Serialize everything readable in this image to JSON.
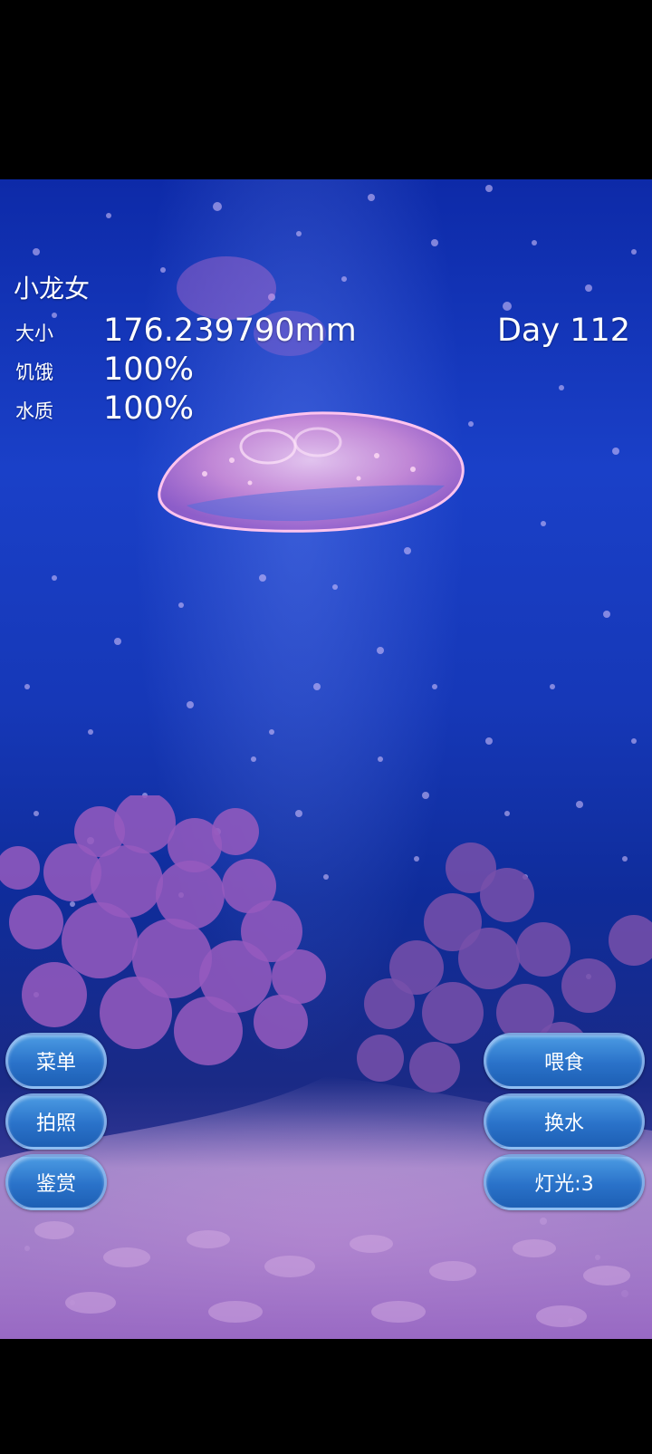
{
  "pet": {
    "name": "小龙女",
    "day": "Day 112"
  },
  "stats": {
    "size_label": "大小",
    "size_value": "176.239790mm",
    "hunger_label": "饥饿",
    "hunger_value": "100%",
    "water_label": "水质",
    "water_value": "100%"
  },
  "buttons": {
    "menu": "菜单",
    "photo": "拍照",
    "appreciate": "鉴赏",
    "feed": "喂食",
    "change_water": "换水",
    "light": "灯光:3"
  },
  "colors": {
    "water_top": "#0d2aa8",
    "water_bottom": "#6b4fb0",
    "button_fill": "#2a72c9",
    "jellyfish": "#f0a0d8"
  }
}
